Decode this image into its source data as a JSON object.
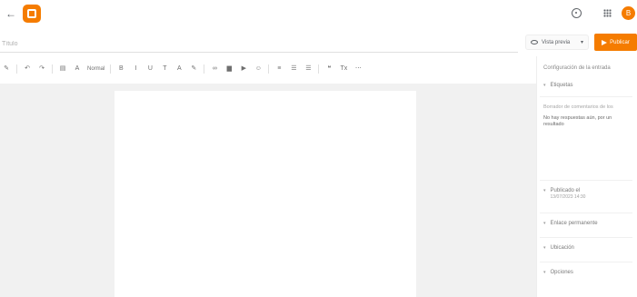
{
  "header": {
    "back_icon": "arrow-left-icon",
    "logo_icon": "blogger-logo-icon",
    "help_icon": "help-circle-icon",
    "apps_icon": "apps-grid-icon",
    "avatar_letter": "B",
    "brand_color": "#f57c00"
  },
  "title_field": {
    "placeholder": "Título",
    "value": ""
  },
  "actions": {
    "preview_label": "Vista previa",
    "publish_label": "Publicar"
  },
  "toolbar": {
    "pencil": "✎",
    "undo": "↶",
    "redo": "↷",
    "format_icon": "▤",
    "text_format": "A",
    "font": "Normal",
    "bold": "B",
    "italic": "I",
    "underline": "U",
    "strike": "T",
    "text_color": "A",
    "highlight": "✎",
    "link": "∞",
    "image": "▆",
    "video": "▶",
    "special": "☺",
    "align": "≡",
    "list_numbered": "☰",
    "list_bulleted": "☰",
    "quote": "❝",
    "clear": "Tx",
    "more": "⋯"
  },
  "sidebar": {
    "heading": "Configuración de la entrada",
    "labels_title": "Etiquetas",
    "reader_comments_label": "Borrador de comentarios de los",
    "reader_comments_value": "No hay respuestas aún, por un resultado",
    "published_title": "Publicado el",
    "published_date": "13/07/2023 14:30",
    "permalink_title": "Enlace permanente",
    "location_title": "Ubicación",
    "options_title": "Opciones"
  }
}
